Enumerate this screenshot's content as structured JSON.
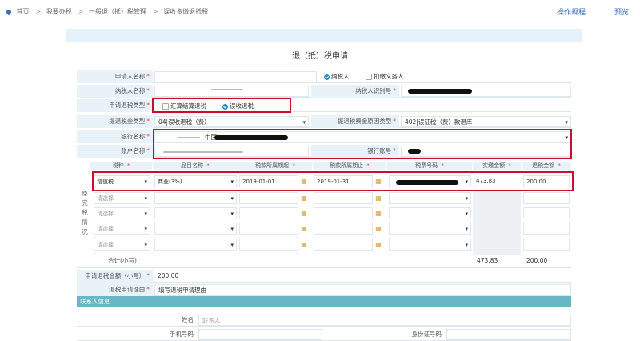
{
  "breadcrumb": [
    "首页",
    "我要办税",
    "一般退（抵）税管理",
    "误收多缴退抵税"
  ],
  "top_links": {
    "process": "操作规程",
    "preview": "预览"
  },
  "form_title": "退（抵）税申请",
  "labels": {
    "applicant": "申请人名称",
    "taxpayer_name": "纳税人名称",
    "taxpayer_id": "纳税人识别号",
    "refund_type": "申请退税类型",
    "tax_class": "提退税金类型",
    "tax_reason": "提退税费金原因类型",
    "bank_name": "银行名称",
    "account_name": "账户名称",
    "bank_account": "银行账号",
    "total": "合计(小写)",
    "refund_amount": "申请退税金额（小写）",
    "refund_reason": "退税申请理由",
    "name": "姓名",
    "phone": "手机号码",
    "id_no": "身份证号码"
  },
  "applicant_roles": {
    "taxpayer": "纳税人",
    "withholder": "扣缴义务人"
  },
  "refund_types": {
    "settlement": "汇算结算退税",
    "mistaken": "误收退税"
  },
  "values": {
    "tax_class": "04|误收退税（费）",
    "tax_reason": "402|误征税（费）款退库",
    "bank_name_fragment": "中国",
    "refund_amount": "200.00",
    "refund_reason": "填写退税申请理由"
  },
  "table": {
    "headers": [
      "税种",
      "品目名称",
      "税款所属期起",
      "税款所属期止",
      "税票号码",
      "实缴金额",
      "退税金额"
    ],
    "side_label": [
      "原",
      "完",
      "税",
      "情",
      "况"
    ],
    "row1": {
      "tax": "增值税",
      "item": "商业(3%)",
      "start": "2019-01-01",
      "end": "2019-01-31",
      "paid": "473.83",
      "refund": "200.00"
    },
    "placeholder": "请选择",
    "total_paid": "473.83",
    "total_refund": "200.00"
  },
  "contact": {
    "section_title": "联系人信息",
    "name_placeholder": "联系人"
  },
  "required_mark": "*",
  "colors": {
    "accent": "#2b86c8",
    "highlight": "#c8102e",
    "section": "#69b7c6"
  }
}
